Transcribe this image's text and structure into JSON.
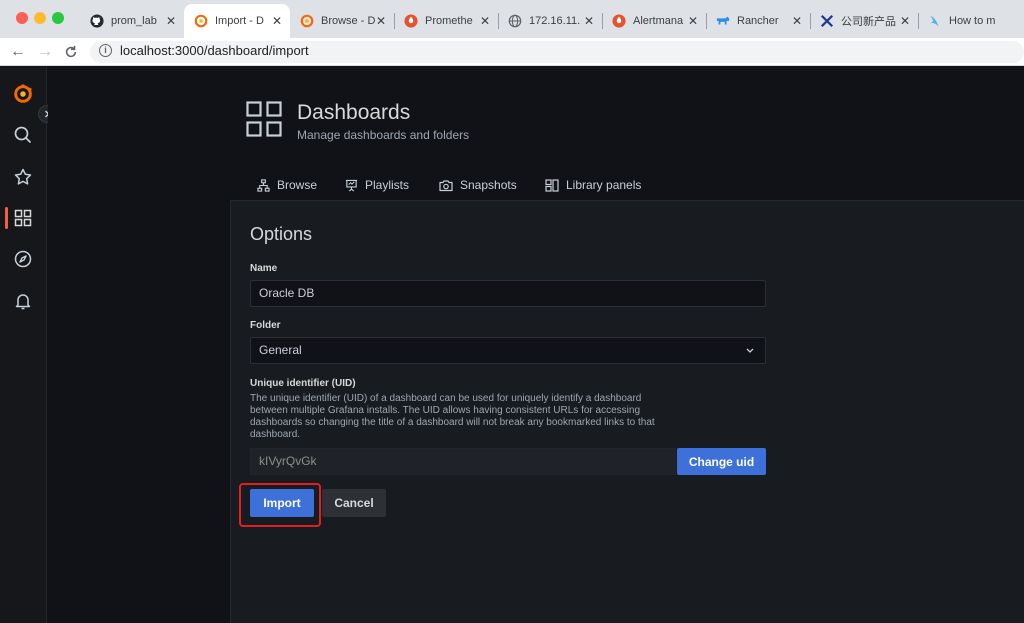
{
  "browser": {
    "tabs": [
      {
        "label": "prom_lab",
        "icon": "github-icon",
        "active": false
      },
      {
        "label": "Import - D",
        "icon": "grafana-icon",
        "active": true
      },
      {
        "label": "Browse - D",
        "icon": "grafana-icon",
        "active": false
      },
      {
        "label": "Promethe",
        "icon": "prometheus-icon",
        "active": false
      },
      {
        "label": "172.16.11.",
        "icon": "globe-icon",
        "active": false
      },
      {
        "label": "Alertmana",
        "icon": "alertmanager-icon",
        "active": false
      },
      {
        "label": "Rancher",
        "icon": "rancher-icon",
        "active": false
      },
      {
        "label": "公司新产品",
        "icon": "tools-icon",
        "active": false
      },
      {
        "label": "How to m",
        "icon": "bird-icon",
        "active": false
      }
    ],
    "url": "localhost:3000/dashboard/import"
  },
  "page": {
    "title": "Dashboards",
    "subtitle": "Manage dashboards and folders",
    "tabs": [
      {
        "label": "Browse",
        "icon": "sitemap-icon"
      },
      {
        "label": "Playlists",
        "icon": "presentation-icon"
      },
      {
        "label": "Snapshots",
        "icon": "camera-icon"
      },
      {
        "label": "Library panels",
        "icon": "library-panels-icon"
      }
    ]
  },
  "options": {
    "title": "Options",
    "name_label": "Name",
    "name_value": "Oracle DB",
    "folder_label": "Folder",
    "folder_value": "General",
    "uid_label": "Unique identifier (UID)",
    "uid_description": "The unique identifier (UID) of a dashboard can be used for uniquely identify a dashboard between multiple Grafana installs. The UID allows having consistent URLs for accessing dashboards so changing the title of a dashboard will not break any bookmarked links to that dashboard.",
    "uid_value": "kIVyrQvGk",
    "change_uid_label": "Change uid",
    "import_label": "Import",
    "cancel_label": "Cancel"
  },
  "colors": {
    "accent": "#f55f3e",
    "primary": "#3d71d9",
    "highlight": "#e02020"
  }
}
